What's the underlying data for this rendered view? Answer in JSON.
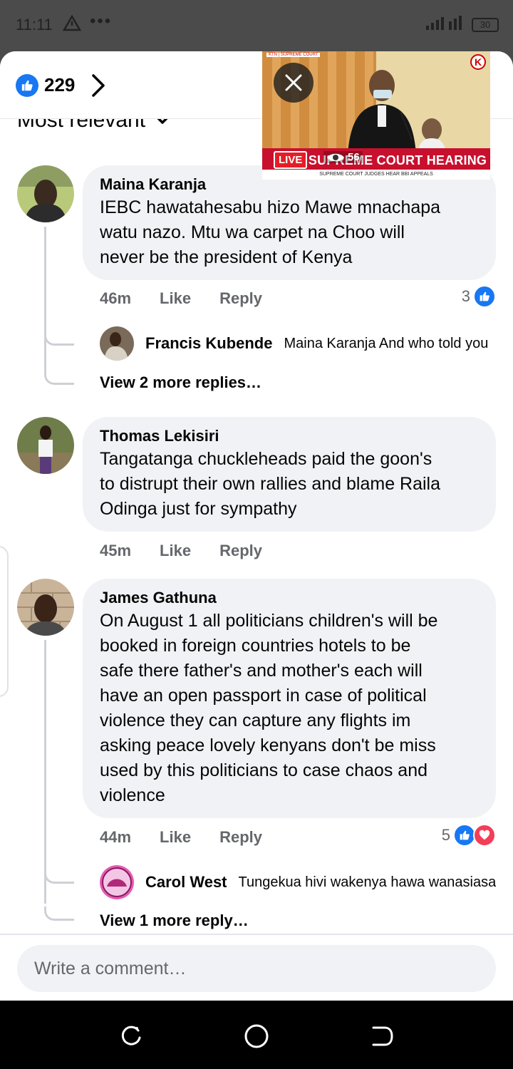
{
  "status_bar": {
    "time": "11:11",
    "battery": "30",
    "dots": "•••"
  },
  "header": {
    "like_count": "229",
    "sort_label": "Most relevant"
  },
  "video": {
    "live_label": "LIVE",
    "view_count": "56",
    "headline": "SUPREME COURT HEARING",
    "subline": "SUPREME COURT JUDGES HEAR BBI APPEALS",
    "channel_tag": "KTN | SUPREME COURT",
    "logo_letter": "K"
  },
  "comments": [
    {
      "author": "Maina Karanja",
      "lines": [
        "IEBC hawatahesabu hizo Mawe mnachapa",
        "watu nazo. Mtu wa carpet na Choo will",
        "never be the president of Kenya"
      ],
      "time": "46m",
      "like_label": "Like",
      "reply_label": "Reply",
      "reaction_count": "3",
      "reply": {
        "author": "Francis Kubende",
        "text": "Maina Karanja And who told you"
      },
      "view_more": "View 2 more replies…"
    },
    {
      "author": "Thomas Lekisiri",
      "lines": [
        "Tangatanga chuckleheads paid the goon's",
        "to distrupt their own rallies and blame Raila",
        "Odinga just for sympathy"
      ],
      "time": "45m",
      "like_label": "Like",
      "reply_label": "Reply"
    },
    {
      "author": "James Gathuna",
      "lines": [
        "On August 1 all politicians children's will be",
        "booked in foreign countries hotels to be",
        "safe there father's and mother's each will",
        "have an open passport in case of political",
        "violence they can capture any flights im",
        "asking peace lovely kenyans don't be miss",
        "used by this politicians to case chaos and",
        "violence"
      ],
      "time": "44m",
      "like_label": "Like",
      "reply_label": "Reply",
      "reaction_count": "5",
      "reply": {
        "author": "Carol West",
        "text": "Tungekua hivi wakenya hawa wanasiasa"
      },
      "view_more": "View 1 more reply…"
    }
  ],
  "composer": {
    "placeholder": "Write a comment…"
  },
  "colors": {
    "facebook_blue": "#1877f2",
    "love_red": "#f33e58",
    "bubble_gray": "#f0f2f5",
    "live_red": "#c8102e"
  }
}
